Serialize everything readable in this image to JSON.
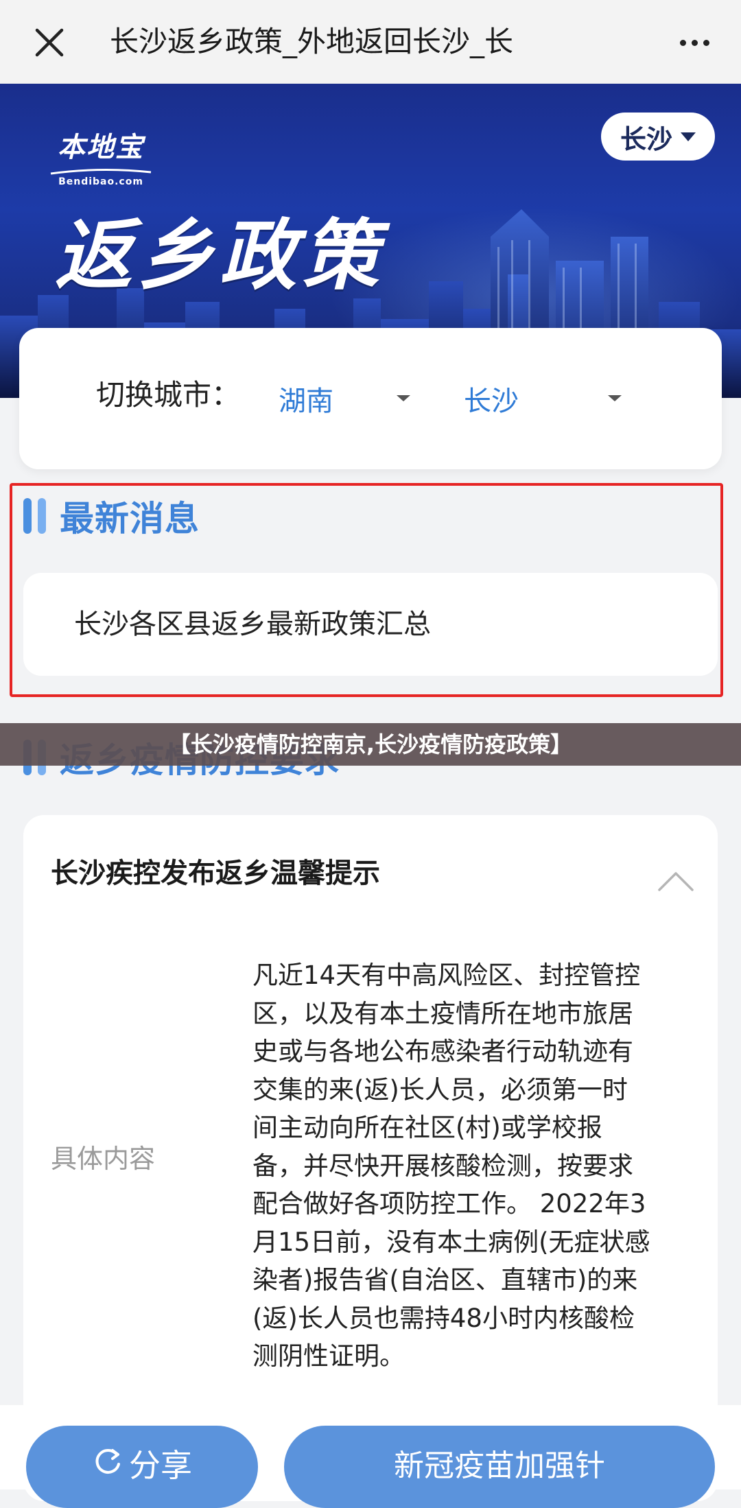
{
  "nav": {
    "title": "长沙返乡政策_外地返回长沙_长"
  },
  "banner": {
    "brand_name": "本地宝",
    "brand_domain": "Bendibao.com",
    "title": "返乡政策",
    "city_selected": "长沙"
  },
  "city_switch": {
    "label": "切换城市：",
    "province": "湖南",
    "city": "长沙"
  },
  "latest_news": {
    "heading": "最新消息",
    "items": [
      "长沙各区县返乡最新政策汇总"
    ]
  },
  "caption": "【长沙疫情防控南京,长沙疫情防疫政策】",
  "requirements": {
    "heading": "返乡疫情防控要求"
  },
  "policy": {
    "title": "长沙疾控发布返乡温馨提示",
    "field_label": "具体内容",
    "content_lines": [
      "凡近14天有中高风险区、封控管控",
      "区，以及有本土疫情所在地市旅居",
      "史或与各地公布感染者行动轨迹有",
      "交集的来(返)长人员，必须第一时",
      "间主动向所在社区(村)或学校报",
      "备，并尽快开展核酸检测，按要求",
      "配合做好各项防控工作。 2022年3",
      "月15日前，没有本土病例(无症状感",
      "染者)报告省(自治区、直辖市)的来",
      "(返)长人员也需持48小时内核酸检",
      "测阴性证明。"
    ]
  },
  "bottom": {
    "share_label": "分享",
    "vaccine_label": "新冠疫苗加强针"
  },
  "colors": {
    "accent_blue": "#3f83d8",
    "button_blue": "#5b93dc",
    "highlight_red": "#e62424",
    "banner_blue": "#1d3ba8"
  },
  "icons": [
    "close-icon",
    "more-icon",
    "dropdown-triangle-icon",
    "caret-down-icon",
    "chevron-up-icon",
    "share-icon"
  ]
}
